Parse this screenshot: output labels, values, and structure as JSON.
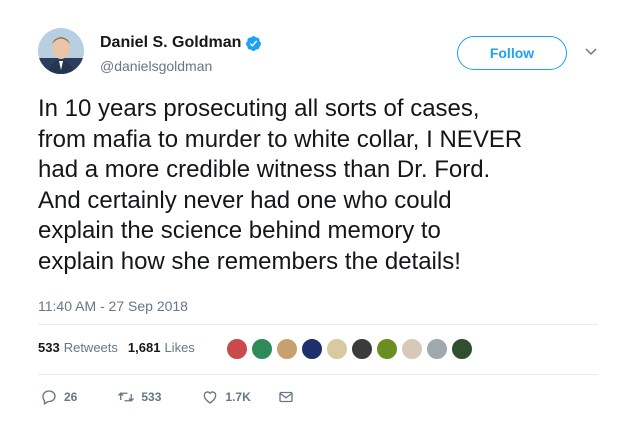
{
  "author": {
    "display_name": "Daniel S. Goldman",
    "handle": "@danielsgoldman",
    "verified": true
  },
  "follow_label": "Follow",
  "tweet_lines": [
    "In 10 years prosecuting all sorts of cases,",
    "from mafia to murder to white collar, I NEVER",
    "had a more credible witness than Dr. Ford.",
    "And certainly never had one who could",
    "explain the science behind memory to",
    "explain how she remembers the details!"
  ],
  "timestamp": "11:40 AM - 27 Sep 2018",
  "stats": {
    "retweets_count": "533",
    "retweets_label": "Retweets",
    "likes_count": "1,681",
    "likes_label": "Likes"
  },
  "liker_colors": [
    "#c94a4a",
    "#2e8b57",
    "#c8a070",
    "#1e2f6e",
    "#d9c9a0",
    "#3b3b3b",
    "#6b8e23",
    "#d8c8b8",
    "#a0a8b0",
    "#2f4f2f"
  ],
  "actions": {
    "reply_count": "26",
    "retweet_count": "533",
    "like_count": "1.7K"
  },
  "colors": {
    "accent": "#1da1f2",
    "text": "#14171a",
    "muted": "#657786"
  }
}
